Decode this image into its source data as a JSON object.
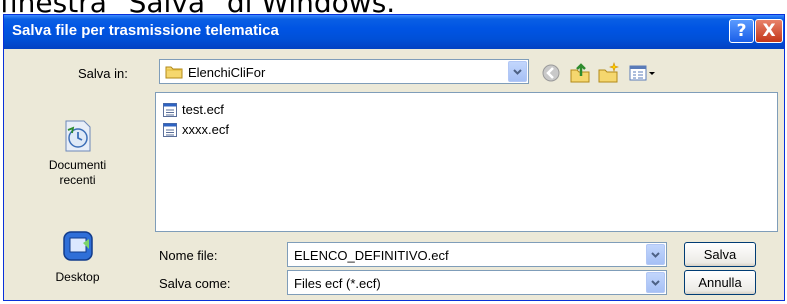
{
  "caption": "finestra \"Salva\" di Windows.",
  "window": {
    "title": "Salva file per trasmissione telematica",
    "help_label": "?",
    "close_label": "X"
  },
  "save_in": {
    "label": "Salva in:",
    "value": "ElenchiCliFor",
    "folder_icon": "folder-icon"
  },
  "toolbar": {
    "icons": [
      "back-icon",
      "up-folder-icon",
      "new-folder-icon",
      "view-menu-icon"
    ]
  },
  "places": [
    {
      "label": "Documenti recenti",
      "icon": "recent-documents-icon"
    },
    {
      "label": "Desktop",
      "icon": "desktop-icon"
    }
  ],
  "files": [
    {
      "name": "test.ecf",
      "icon": "file-icon"
    },
    {
      "name": "xxxx.ecf",
      "icon": "file-icon"
    }
  ],
  "file_name": {
    "label": "Nome file:",
    "value": "ELENCO_DEFINITIVO.ecf"
  },
  "save_as": {
    "label": "Salva come:",
    "value": "Files ecf (*.ecf)"
  },
  "buttons": {
    "save": "Salva",
    "cancel": "Annulla"
  },
  "colors": {
    "titlebar": "#0054e3",
    "dialog_background": "#ece9d8",
    "field_border": "#7f9db9"
  }
}
